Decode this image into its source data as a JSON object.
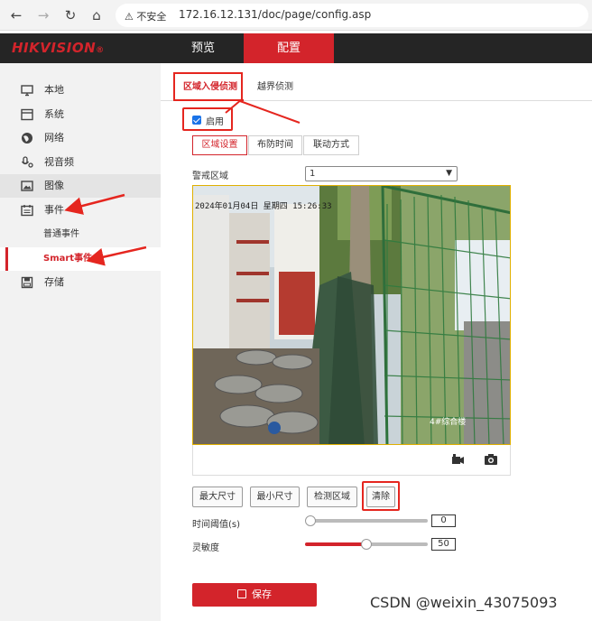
{
  "browser": {
    "back_icon": "←",
    "forward_icon": "→",
    "reload_icon": "↻",
    "home_icon": "⌂",
    "security_warning": "⚠ 不安全",
    "url": "172.16.12.131/doc/page/config.asp"
  },
  "header": {
    "logo": "HIKVISION",
    "logo_mark": "®",
    "tabs": [
      {
        "label": "预览",
        "active": false
      },
      {
        "label": "配置",
        "active": true
      }
    ]
  },
  "sidebar": {
    "items": [
      {
        "label": "本地",
        "icon": "monitor-icon"
      },
      {
        "label": "系统",
        "icon": "system-icon"
      },
      {
        "label": "网络",
        "icon": "globe-icon"
      },
      {
        "label": "视音频",
        "icon": "mic-icon"
      },
      {
        "label": "图像",
        "icon": "image-icon"
      },
      {
        "label": "事件",
        "icon": "calendar-icon"
      },
      {
        "label": "存储",
        "icon": "disk-icon"
      }
    ],
    "sub_items": [
      {
        "label": "普通事件",
        "selected": false
      },
      {
        "label": "Smart事件",
        "selected": true
      }
    ]
  },
  "subtabs": [
    {
      "label": "区域入侵侦测",
      "active": true
    },
    {
      "label": "越界侦测",
      "active": false
    }
  ],
  "enable": {
    "label": "启用",
    "checked": true
  },
  "steps": [
    {
      "label": "区域设置",
      "active": true
    },
    {
      "label": "布防时间",
      "active": false
    },
    {
      "label": "联动方式",
      "active": false
    }
  ],
  "alarm_region": {
    "label": "警戒区域",
    "value": "1"
  },
  "video": {
    "osd_timestamp": "2024年01月04日 星期四 15:26:33",
    "osd_channel": "4#综合楼"
  },
  "buttons": {
    "max_size": "最大尺寸",
    "min_size": "最小尺寸",
    "detect_area": "检测区域",
    "clear": "清除"
  },
  "time_threshold": {
    "label": "时间阈值(s)",
    "value": "0",
    "level": 0.0
  },
  "sensitivity": {
    "label": "灵敏度",
    "value": "50",
    "level": 0.5
  },
  "save_label": "保存",
  "watermark": "CSDN @weixin_43075093",
  "colors": {
    "accent": "#d3242b",
    "annotation": "#e5261f"
  }
}
